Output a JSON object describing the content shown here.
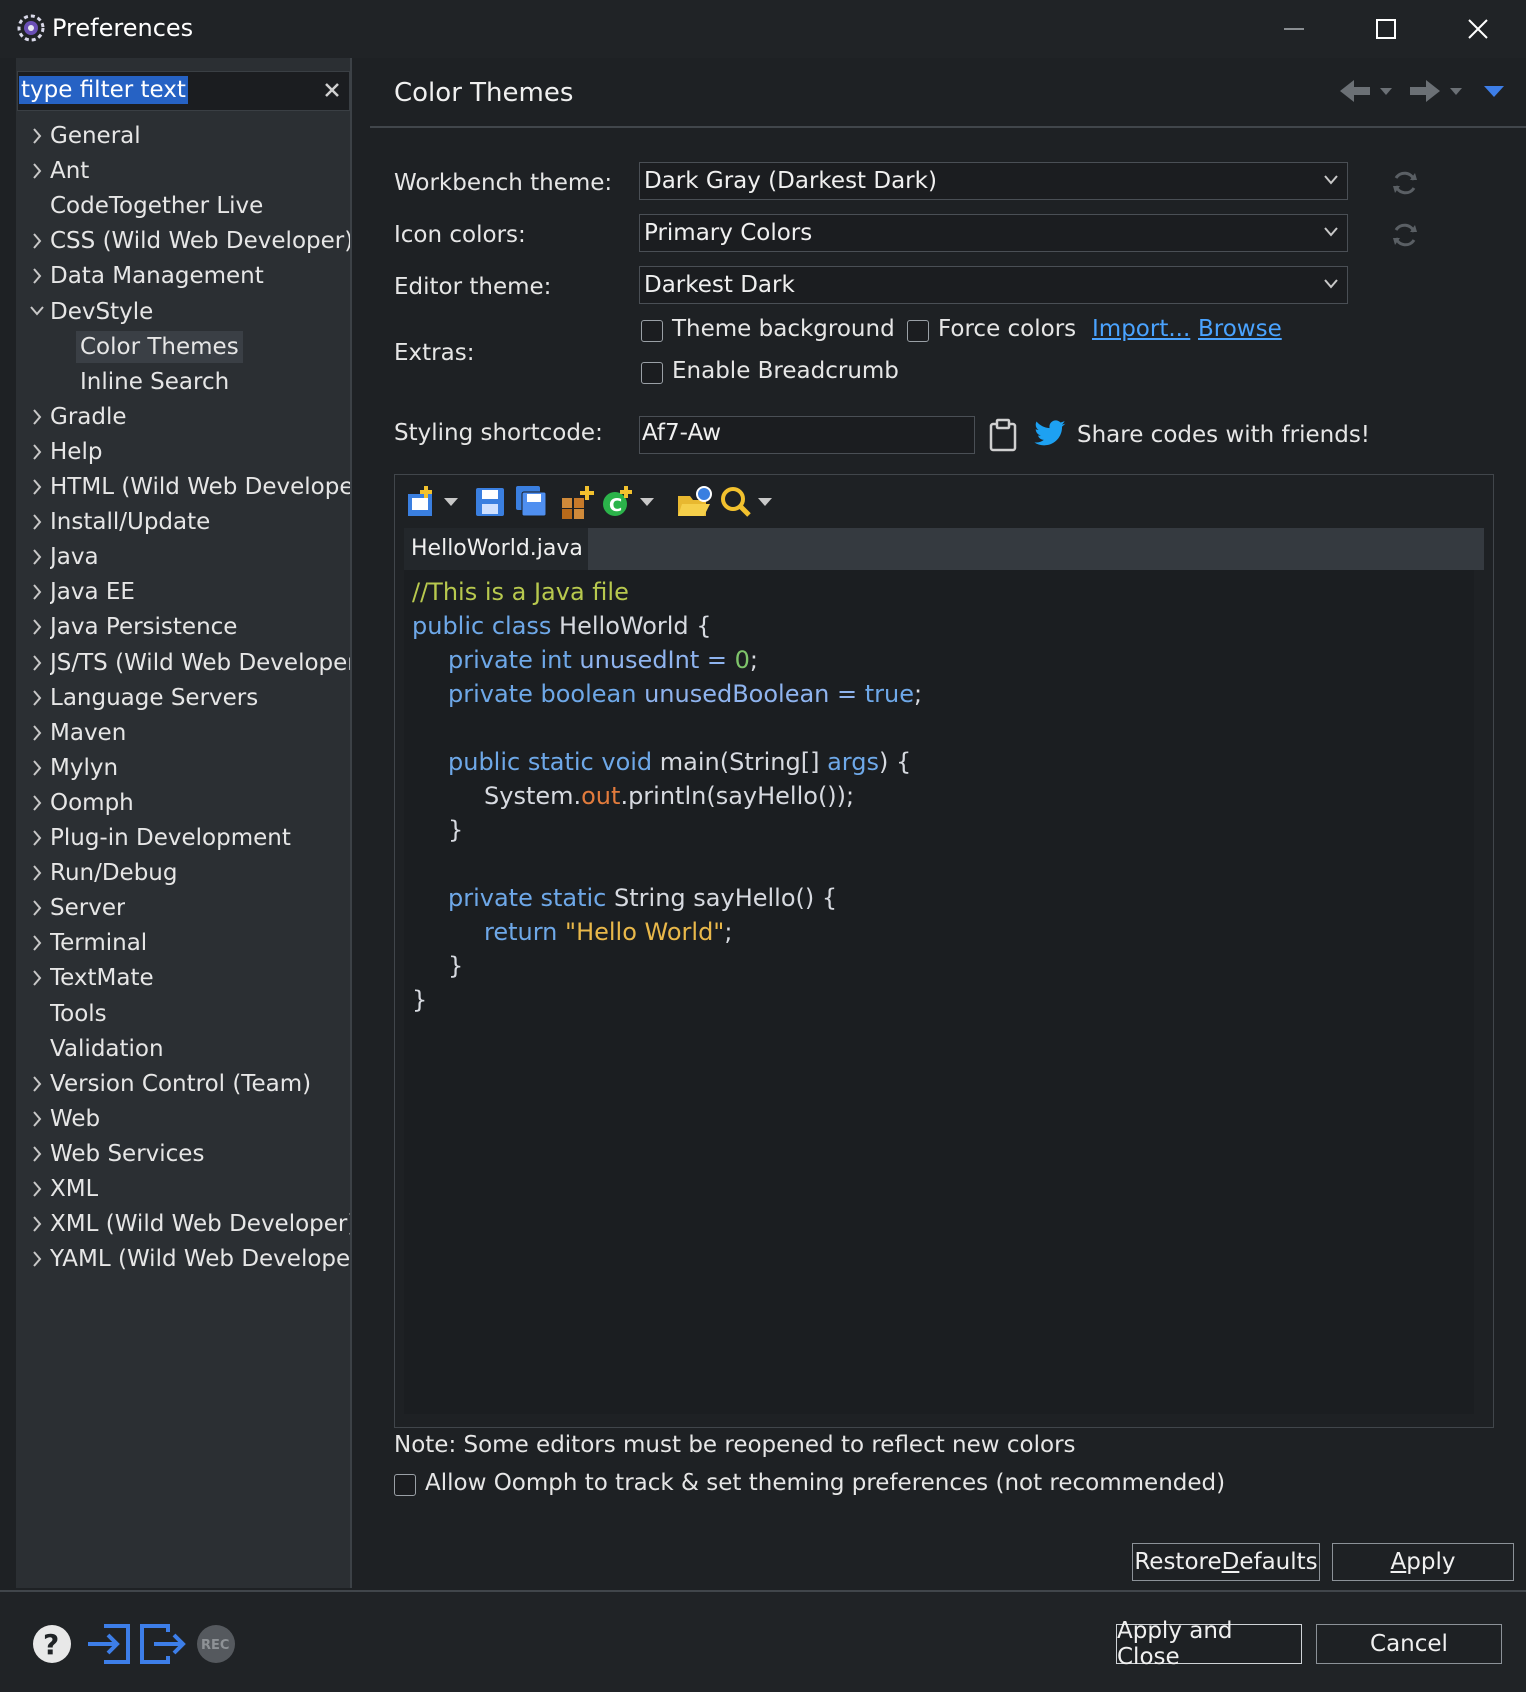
{
  "window": {
    "title": "Preferences",
    "minimize_icon": "minimize-icon",
    "maximize_icon": "maximize-icon",
    "close_icon": "close-icon"
  },
  "filter": {
    "text": "type filter text",
    "clear_icon": "clear-icon"
  },
  "tree": [
    {
      "label": "General",
      "expandable": true,
      "indent": 0
    },
    {
      "label": "Ant",
      "expandable": true,
      "indent": 0
    },
    {
      "label": "CodeTogether Live",
      "expandable": false,
      "indent": 0
    },
    {
      "label": "CSS (Wild Web Developer)",
      "expandable": true,
      "indent": 0
    },
    {
      "label": "Data Management",
      "expandable": true,
      "indent": 0
    },
    {
      "label": "DevStyle",
      "expandable": true,
      "expanded": true,
      "indent": 0
    },
    {
      "label": "Color Themes",
      "expandable": false,
      "indent": 1,
      "selected": true
    },
    {
      "label": "Inline Search",
      "expandable": false,
      "indent": 1
    },
    {
      "label": "Gradle",
      "expandable": true,
      "indent": 0
    },
    {
      "label": "Help",
      "expandable": true,
      "indent": 0
    },
    {
      "label": "HTML (Wild Web Develope",
      "expandable": true,
      "indent": 0
    },
    {
      "label": "Install/Update",
      "expandable": true,
      "indent": 0
    },
    {
      "label": "Java",
      "expandable": true,
      "indent": 0
    },
    {
      "label": "Java EE",
      "expandable": true,
      "indent": 0
    },
    {
      "label": "Java Persistence",
      "expandable": true,
      "indent": 0
    },
    {
      "label": "JS/TS (Wild Web Developer",
      "expandable": true,
      "indent": 0
    },
    {
      "label": "Language Servers",
      "expandable": true,
      "indent": 0
    },
    {
      "label": "Maven",
      "expandable": true,
      "indent": 0
    },
    {
      "label": "Mylyn",
      "expandable": true,
      "indent": 0
    },
    {
      "label": "Oomph",
      "expandable": true,
      "indent": 0
    },
    {
      "label": "Plug-in Development",
      "expandable": true,
      "indent": 0
    },
    {
      "label": "Run/Debug",
      "expandable": true,
      "indent": 0
    },
    {
      "label": "Server",
      "expandable": true,
      "indent": 0
    },
    {
      "label": "Terminal",
      "expandable": true,
      "indent": 0
    },
    {
      "label": "TextMate",
      "expandable": true,
      "indent": 0
    },
    {
      "label": "Tools",
      "expandable": false,
      "indent": 0
    },
    {
      "label": "Validation",
      "expandable": false,
      "indent": 0
    },
    {
      "label": "Version Control (Team)",
      "expandable": true,
      "indent": 0
    },
    {
      "label": "Web",
      "expandable": true,
      "indent": 0
    },
    {
      "label": "Web Services",
      "expandable": true,
      "indent": 0
    },
    {
      "label": "XML",
      "expandable": true,
      "indent": 0
    },
    {
      "label": "XML (Wild Web Developer)",
      "expandable": true,
      "indent": 0
    },
    {
      "label": "YAML (Wild Web Develope",
      "expandable": true,
      "indent": 0
    }
  ],
  "page": {
    "title": "Color Themes",
    "nav_icons": [
      "back-arrow-icon",
      "forward-arrow-icon",
      "view-menu-icon"
    ]
  },
  "form": {
    "workbench_label": "Workbench theme:",
    "workbench_value": "Dark Gray (Darkest Dark)",
    "icon_label": "Icon colors:",
    "icon_value": "Primary Colors",
    "editor_label": "Editor theme:",
    "editor_value": "Darkest Dark",
    "extras_label": "Extras:",
    "theme_bg_label": "Theme background",
    "force_colors_label": "Force colors",
    "import_link": "Import...",
    "browse_link": "Browse",
    "breadcrumb_label": "Enable Breadcrumb",
    "shortcode_label": "Styling shortcode:",
    "shortcode_value": "Af7-Aw",
    "share_text": "Share codes with friends!"
  },
  "preview": {
    "tab_label": "HelloWorld.java",
    "toolbar_icons": [
      "new-file-icon",
      "save-icon",
      "save-all-icon",
      "new-package-icon",
      "new-class-icon",
      "open-folder-icon",
      "search-icon"
    ],
    "code": {
      "line1": "//This is a Java file",
      "line2_kw": "public class",
      "line2_rest": " HelloWorld {",
      "line3_kw": "private int",
      "line3_id": " unusedInt = ",
      "line3_num": "0",
      "line3_end": ";",
      "line4_kw": "private boolean",
      "line4_id": " unusedBoolean = ",
      "line4_val": "true",
      "line4_end": ";",
      "line6_kw": "public static void",
      "line6_mid": " main(String[] ",
      "line6_arg": "args",
      "line6_end": ") {",
      "line7_a": "System.",
      "line7_field": "out",
      "line7_b": ".println(sayHello());",
      "line8": "}",
      "line10_kw": "private static",
      "line10_rest": " String sayHello() {",
      "line11_kw": "return",
      "line11_str": "\"Hello World\"",
      "line11_end": ";",
      "line12": "}",
      "line13": "}"
    }
  },
  "footer": {
    "note": "Note: Some editors must be reopened to reflect new colors",
    "oomph_label": "Allow Oomph to track & set theming preferences (not recommended)",
    "restore_pre": "Restore ",
    "restore_u": "D",
    "restore_post": "efaults",
    "apply_u": "A",
    "apply_post": "pply",
    "apply_close": "Apply and Close",
    "cancel": "Cancel",
    "bottom_icons": [
      "help-icon",
      "import-icon",
      "export-icon",
      "record-icon"
    ],
    "rec_text": "REC"
  },
  "colors": {
    "accent": "#2662c4",
    "link": "#4aa3ff",
    "twitter": "#1da1f2"
  }
}
